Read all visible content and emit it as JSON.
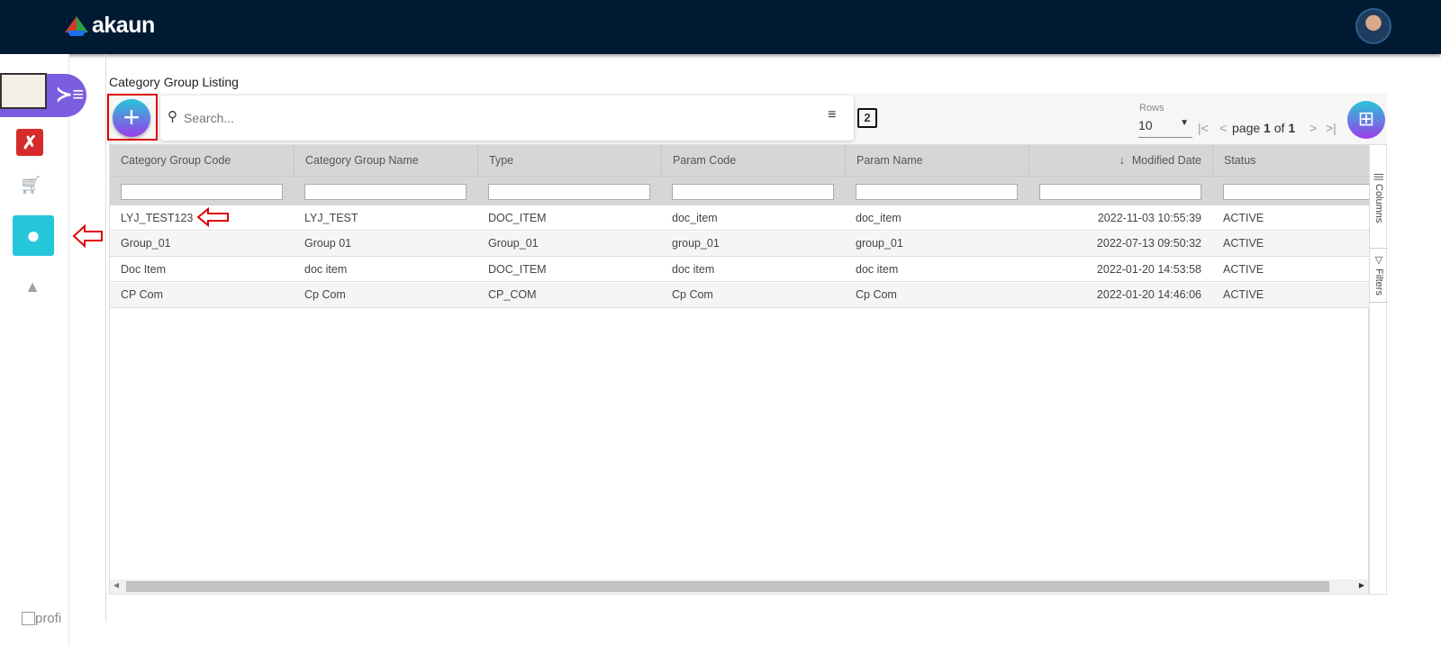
{
  "app": {
    "brand": "akaun"
  },
  "page": {
    "title": "Category Group Listing"
  },
  "search": {
    "placeholder": "Search..."
  },
  "pagination": {
    "rows_label": "Rows",
    "rows_value": "10",
    "page_word": "page",
    "current": "1",
    "of_word": "of",
    "total": "1"
  },
  "grid": {
    "columns": [
      "Category Group Code",
      "Category Group Name",
      "Type",
      "Param Code",
      "Param Name",
      "Modified Date",
      "Status"
    ],
    "sort_indicator": "↓",
    "rows": [
      [
        "LYJ_TEST123",
        "LYJ_TEST",
        "DOC_ITEM",
        "doc_item",
        "doc_item",
        "2022-11-03 10:55:39",
        "ACTIVE"
      ],
      [
        "Group_01",
        "Group 01",
        "Group_01",
        "group_01",
        "group_01",
        "2022-07-13 09:50:32",
        "ACTIVE"
      ],
      [
        "Doc Item",
        "doc item",
        "DOC_ITEM",
        "doc item",
        "doc item",
        "2022-01-20 14:53:58",
        "ACTIVE"
      ],
      [
        "CP Com",
        "Cp Com",
        "CP_COM",
        "Cp Com",
        "Cp Com",
        "2022-01-20 14:46:06",
        "ACTIVE"
      ]
    ],
    "side_tabs": [
      "Columns",
      "Filters"
    ]
  },
  "footer": {
    "profile_label": "profi"
  },
  "colors": {
    "topbar": "#001a33",
    "accent": "#7b5de0",
    "active_app": "#26c6da",
    "highlight": "#e00000"
  }
}
